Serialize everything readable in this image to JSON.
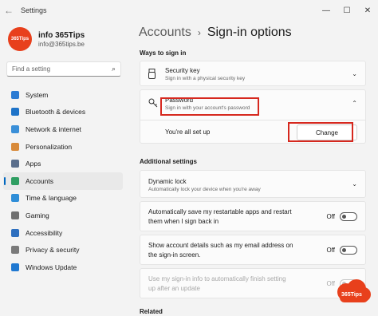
{
  "window": {
    "title": "Settings",
    "back": "←",
    "minimize": "—",
    "maximize": "☐",
    "close": "✕"
  },
  "profile": {
    "name": "info 365Tips",
    "email": "info@365tips.be",
    "avatar_text": "365Tips"
  },
  "search": {
    "placeholder": "Find a setting"
  },
  "nav": [
    {
      "label": "System",
      "icon": "monitor-icon",
      "color": "#2b7bd3"
    },
    {
      "label": "Bluetooth & devices",
      "icon": "bluetooth-icon",
      "color": "#1e73c8"
    },
    {
      "label": "Network & internet",
      "icon": "wifi-icon",
      "color": "#3a8fd8"
    },
    {
      "label": "Personalization",
      "icon": "brush-icon",
      "color": "#d88a3a"
    },
    {
      "label": "Apps",
      "icon": "apps-icon",
      "color": "#5a6e8c"
    },
    {
      "label": "Accounts",
      "icon": "person-icon",
      "color": "#2f9e62",
      "active": true
    },
    {
      "label": "Time & language",
      "icon": "globe-clock-icon",
      "color": "#2f8ed8"
    },
    {
      "label": "Gaming",
      "icon": "controller-icon",
      "color": "#707070"
    },
    {
      "label": "Accessibility",
      "icon": "accessibility-icon",
      "color": "#2d6fbf"
    },
    {
      "label": "Privacy & security",
      "icon": "shield-icon",
      "color": "#7a7a7a"
    },
    {
      "label": "Windows Update",
      "icon": "update-icon",
      "color": "#1f78d1"
    }
  ],
  "breadcrumb": {
    "parent": "Accounts",
    "separator": "›",
    "current": "Sign-in options"
  },
  "ways": {
    "title": "Ways to sign in",
    "security_key": {
      "title": "Security key",
      "subtitle": "Sign in with a physical security key"
    },
    "password": {
      "title": "Password",
      "subtitle": "Sign in with your account's password",
      "status": "You're all set up",
      "button": "Change"
    }
  },
  "additional": {
    "title": "Additional settings",
    "dynamic_lock": {
      "title": "Dynamic lock",
      "subtitle": "Automatically lock your device when you're away"
    },
    "restart_apps": {
      "line1": "Automatically save my restartable apps and restart",
      "line2": "them when I sign back in",
      "state": "Off"
    },
    "account_details": {
      "line1": "Show account details such as my email address on",
      "line2": "the sign-in screen.",
      "state": "Off"
    },
    "signin_info": {
      "line1": "Use my sign-in info to automatically finish setting",
      "line2": "up after an update",
      "state": "Off"
    }
  },
  "related": {
    "title": "Related"
  },
  "watermark": {
    "text": "365Tips"
  }
}
